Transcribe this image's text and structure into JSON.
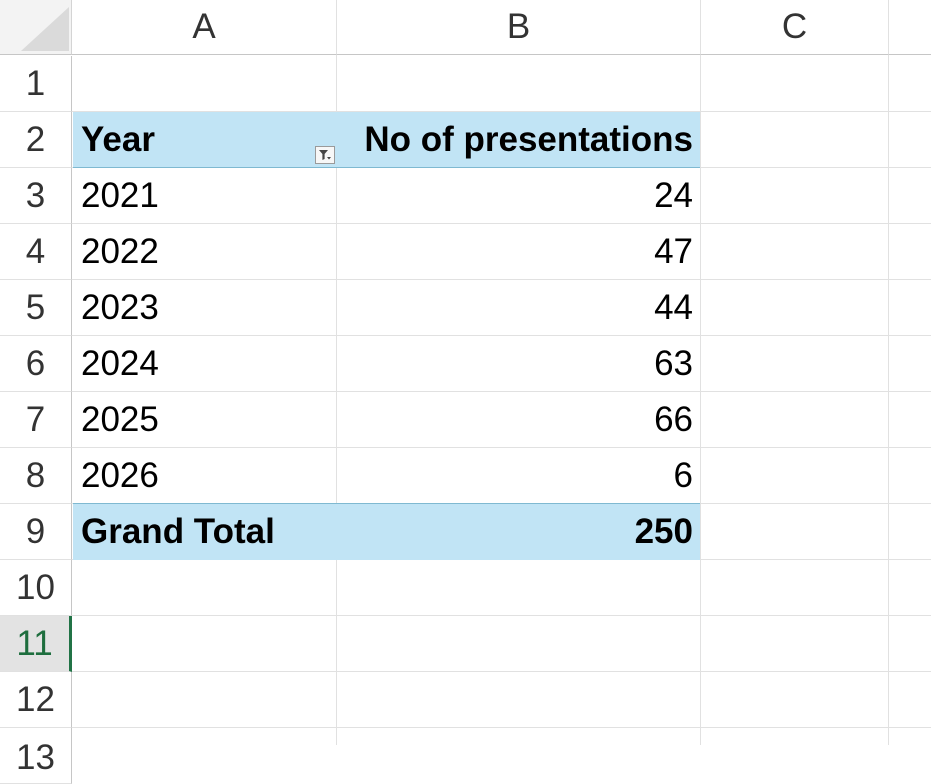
{
  "columns": [
    "A",
    "B",
    "C"
  ],
  "rows": [
    "1",
    "2",
    "3",
    "4",
    "5",
    "6",
    "7",
    "8",
    "9",
    "10",
    "11",
    "12",
    "13"
  ],
  "active_row": "11",
  "pivot": {
    "header": {
      "year": "Year",
      "count": "No of presentations"
    },
    "data": [
      {
        "year": "2021",
        "count": "24"
      },
      {
        "year": "2022",
        "count": "47"
      },
      {
        "year": "2023",
        "count": "44"
      },
      {
        "year": "2024",
        "count": "63"
      },
      {
        "year": "2025",
        "count": "66"
      },
      {
        "year": "2026",
        "count": "6"
      }
    ],
    "total": {
      "label": "Grand Total",
      "count": "250"
    }
  },
  "colors": {
    "pivot_band": "#c1e4f5",
    "active_row_accent": "#217346",
    "gridline": "#e1e1e1"
  },
  "icons": {
    "filter": "filter-dropdown-icon"
  }
}
